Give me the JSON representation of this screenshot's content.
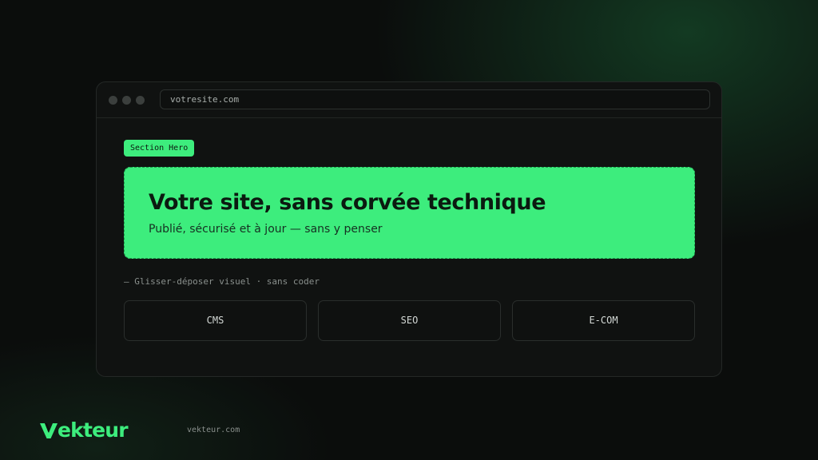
{
  "browser": {
    "url": "votresite.com"
  },
  "editor": {
    "section_tag": "Section Hero",
    "hero": {
      "title": "Votre site, sans corvée technique",
      "subtitle": "Publié, sécurisé et à jour — sans y penser"
    },
    "hint": "— Glisser-déposer visuel · sans coder",
    "features": [
      {
        "label": "CMS"
      },
      {
        "label": "SEO"
      },
      {
        "label": "E-COM"
      }
    ]
  },
  "footer": {
    "brand": "ekteur",
    "brand_full": "Vekteur",
    "url": "vekteur.com"
  },
  "colors": {
    "accent": "#3ded7d",
    "background": "#0b0d0c",
    "panel": "#101211"
  }
}
